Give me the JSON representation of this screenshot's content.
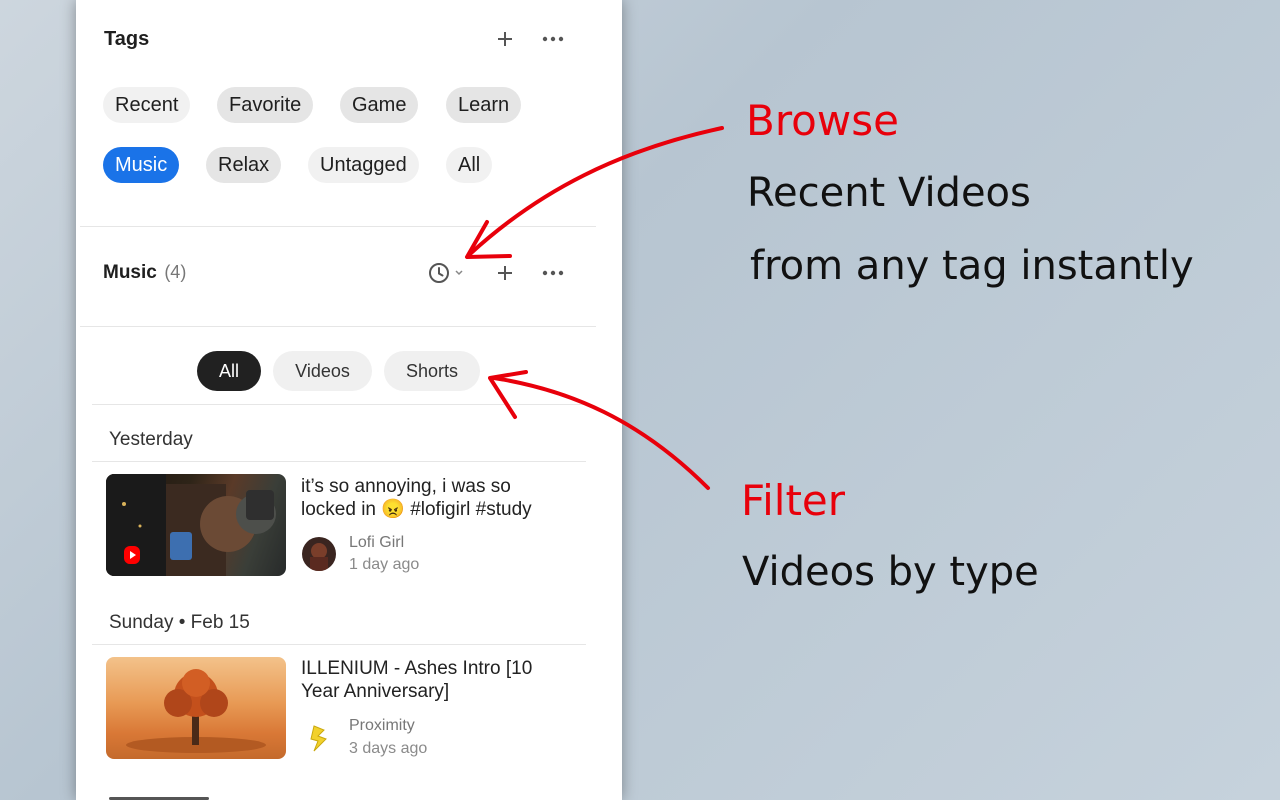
{
  "tags": {
    "title": "Tags",
    "items": [
      "Recent",
      "Favorite",
      "Game",
      "Learn",
      "Music",
      "Relax",
      "Untagged",
      "All"
    ],
    "active": "Music"
  },
  "music": {
    "title": "Music",
    "count": "(4)"
  },
  "filters": {
    "items": [
      "All",
      "Videos",
      "Shorts"
    ],
    "active": "All"
  },
  "groups": [
    {
      "date": "Yesterday",
      "video": {
        "title": "it’s so annoying, i was so locked in 😠 #lofigirl #study",
        "channel": "Lofi Girl",
        "ago": "1 day ago"
      }
    },
    {
      "date": "Sunday • Feb 15",
      "video": {
        "title": "ILLENIUM - Ashes Intro [10 Year Anniversary]",
        "channel": "Proximity",
        "ago": "3 days ago"
      }
    }
  ],
  "annotations": {
    "browse_title": "Browse",
    "browse_line1": "Recent Videos",
    "browse_line2": "from any tag instantly",
    "filter_title": "Filter",
    "filter_line1": "Videos by type"
  },
  "colors": {
    "accent": "#1a73e8",
    "annotation_red": "#e8000b",
    "chip_active": "#212121"
  },
  "icons": [
    "plus-icon",
    "more-icon",
    "clock-icon",
    "chevron-down-icon",
    "shorts-logo-icon"
  ]
}
